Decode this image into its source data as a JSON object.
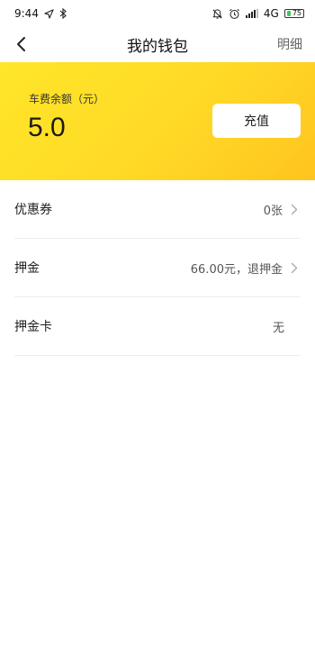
{
  "status_bar": {
    "time": "9:44",
    "network": "4G",
    "battery": "75"
  },
  "nav": {
    "title": "我的钱包",
    "action": "明细"
  },
  "balance": {
    "label": "车费余额（元）",
    "value": "5.0",
    "recharge_label": "充值"
  },
  "list": [
    {
      "label": "优惠券",
      "value": "0张",
      "has_chevron": true
    },
    {
      "label": "押金",
      "value": "66.00元，退押金",
      "has_chevron": true
    },
    {
      "label": "押金卡",
      "value": "无",
      "has_chevron": false
    }
  ],
  "colors": {
    "card_start": "#ffe629",
    "card_end": "#ffc41f"
  }
}
